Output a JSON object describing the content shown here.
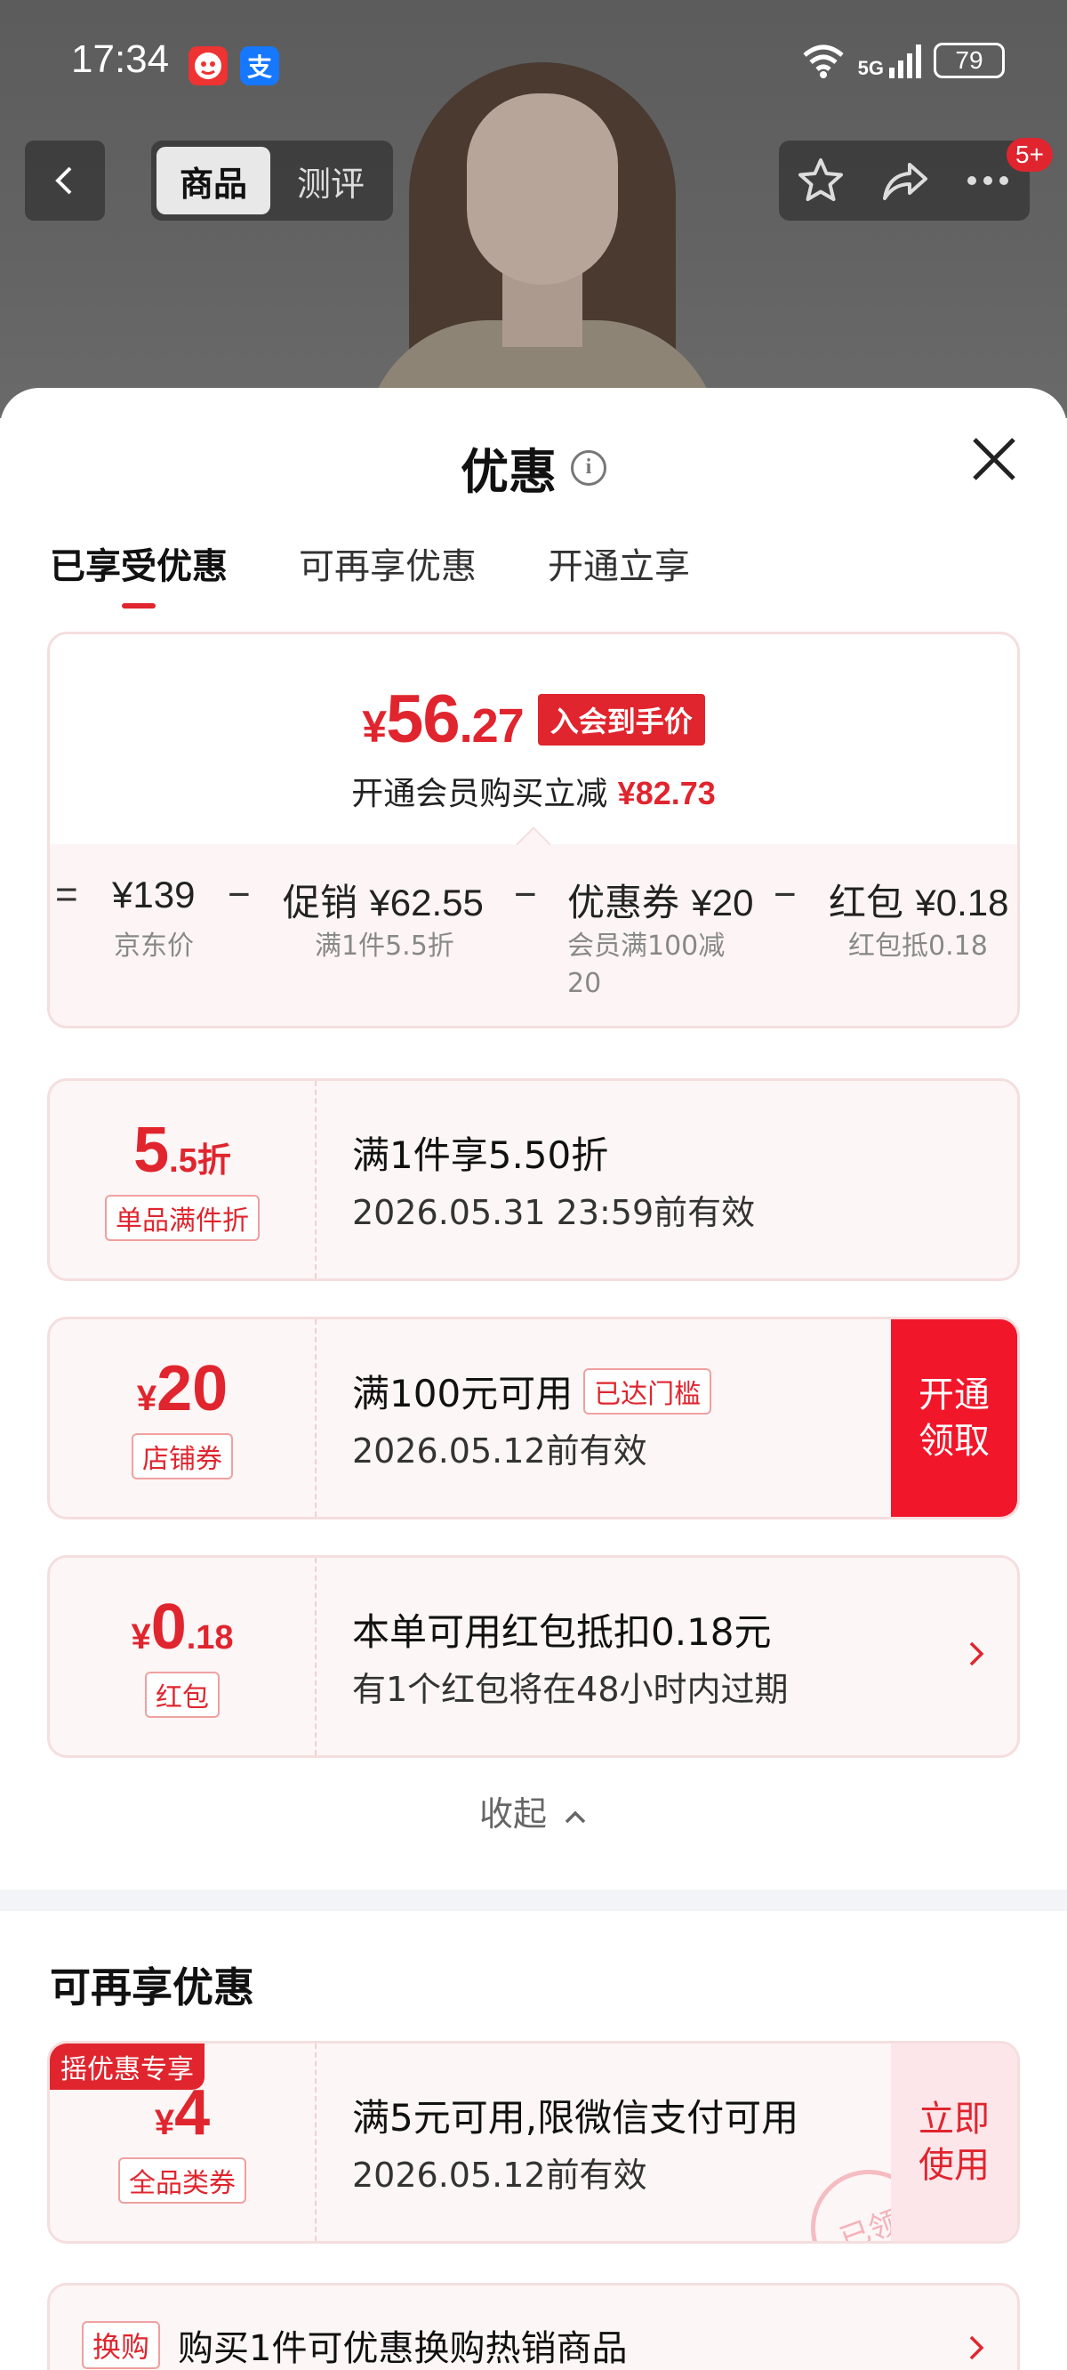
{
  "status_bar": {
    "time": "17:34",
    "app_icons": [
      "app-notification-icon",
      "alipay-icon"
    ],
    "alipay_glyph": "支",
    "network": "5G",
    "battery": "79"
  },
  "nav": {
    "tabs": [
      {
        "label": "商品"
      },
      {
        "label": "测评"
      }
    ],
    "badge": "5+"
  },
  "sheet": {
    "title": "优惠",
    "tabs": [
      {
        "label": "已享受优惠"
      },
      {
        "label": "可再享优惠"
      },
      {
        "label": "开通立享"
      }
    ]
  },
  "price_card": {
    "currency": "¥",
    "price_int": "56",
    "price_dec": ".27",
    "badge": "入会到手价",
    "sub_text": "开通会员购买立减",
    "sub_amount": "¥82.73",
    "breakdown": [
      {
        "op": "=",
        "label": "",
        "value": "¥139",
        "sub": "京东价"
      },
      {
        "op": "−",
        "label": "促销",
        "value": "¥62.55",
        "sub": "满1件5.5折"
      },
      {
        "op": "−",
        "label": "优惠券",
        "value": "¥20",
        "sub": "会员满100减20"
      },
      {
        "op": "−",
        "label": "红包",
        "value": "¥0.18",
        "sub": "红包抵0.18"
      }
    ]
  },
  "coupons": [
    {
      "amount_main": "5",
      "amount_suffix": ".5折",
      "tag": "单品满件折",
      "title": "满1件享5.50折",
      "date": "2026.05.31 23:59前有效"
    },
    {
      "currency": "¥",
      "amount_main": "20",
      "tag": "店铺券",
      "title": "满100元可用",
      "reached": "已达门槛",
      "date": "2026.05.12前有效",
      "action_line1": "开通",
      "action_line2": "领取"
    },
    {
      "currency": "¥",
      "amount_main": "0",
      "amount_suffix": ".18",
      "tag": "红包",
      "title": "本单可用红包抵扣0.18元",
      "date": "有1个红包将在48小时内过期"
    }
  ],
  "collapse_label": "收起",
  "more_section": {
    "title": "可再享优惠",
    "coupon": {
      "promo_label": "摇优惠专享",
      "currency": "¥",
      "amount_main": "4",
      "tag": "全品类券",
      "title": "满5元可用,限微信支付可用",
      "date": "2026.05.12前有效",
      "action_line1": "立即",
      "action_line2": "使用",
      "stamp": "已领"
    },
    "exchange": {
      "tag": "换购",
      "text": "购买1件可优惠换购热销商品"
    }
  },
  "colors": {
    "accent": "#e0252e",
    "action_red": "#f2162a"
  }
}
